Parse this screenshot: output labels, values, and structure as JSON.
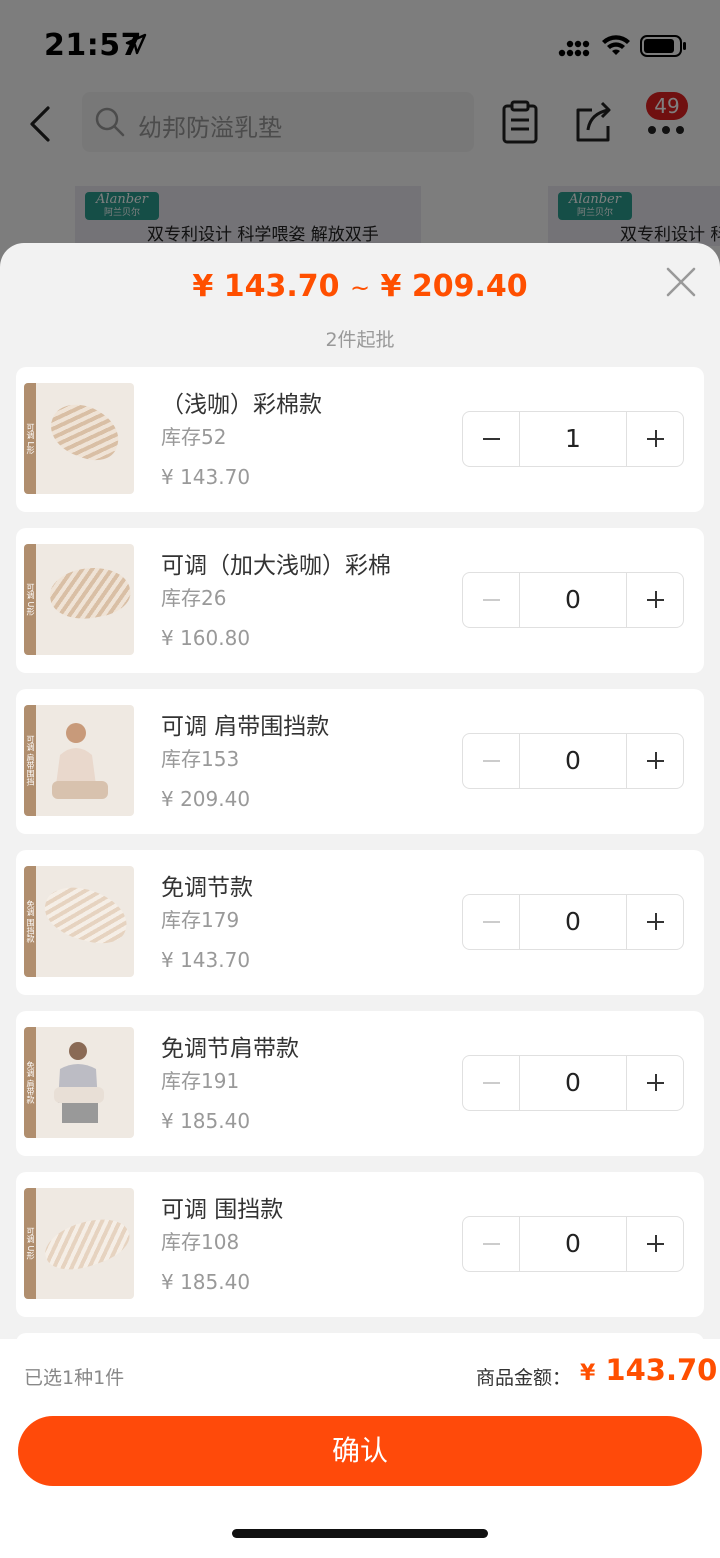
{
  "status_bar": {
    "time": "21:57"
  },
  "nav": {
    "search_placeholder": "幼邦防溢乳垫",
    "cart_badge": "49"
  },
  "banner": {
    "logo_text": "Alanber",
    "logo_sub": "阿兰贝尔",
    "slogan": "双专利设计 科学喂姿 解放双手"
  },
  "sheet": {
    "price_min": "¥ 143.70",
    "price_sep": "~",
    "price_max": "¥ 209.40",
    "min_batch": "2件起批"
  },
  "skus": [
    {
      "name": "（浅咖）彩棉款",
      "stock": "库存52",
      "price": "¥ 143.70",
      "quantity": "1",
      "tag": "可调 L形"
    },
    {
      "name": "可调（加大浅咖）彩棉",
      "stock": "库存26",
      "price": "¥ 160.80",
      "quantity": "0",
      "tag": "可调 U形"
    },
    {
      "name": "可调 肩带围挡款",
      "stock": "库存153",
      "price": "¥ 209.40",
      "quantity": "0",
      "tag": "可调 肩带围挡"
    },
    {
      "name": "免调节款",
      "stock": "库存179",
      "price": "¥ 143.70",
      "quantity": "0",
      "tag": "免调 围挡款"
    },
    {
      "name": "免调节肩带款",
      "stock": "库存191",
      "price": "¥ 185.40",
      "quantity": "0",
      "tag": "免调 肩带款"
    },
    {
      "name": "可调  围挡款",
      "stock": "库存108",
      "price": "¥ 185.40",
      "quantity": "0",
      "tag": "可调 U形"
    }
  ],
  "footer": {
    "selected_info": "已选1种1件",
    "total_label": "商品金额：",
    "total_yen": "¥",
    "total_value": "143.70",
    "confirm_label": "确认"
  },
  "colors": {
    "accent": "#ff4f00",
    "button": "#ff4a0a",
    "badge": "#e02020"
  }
}
